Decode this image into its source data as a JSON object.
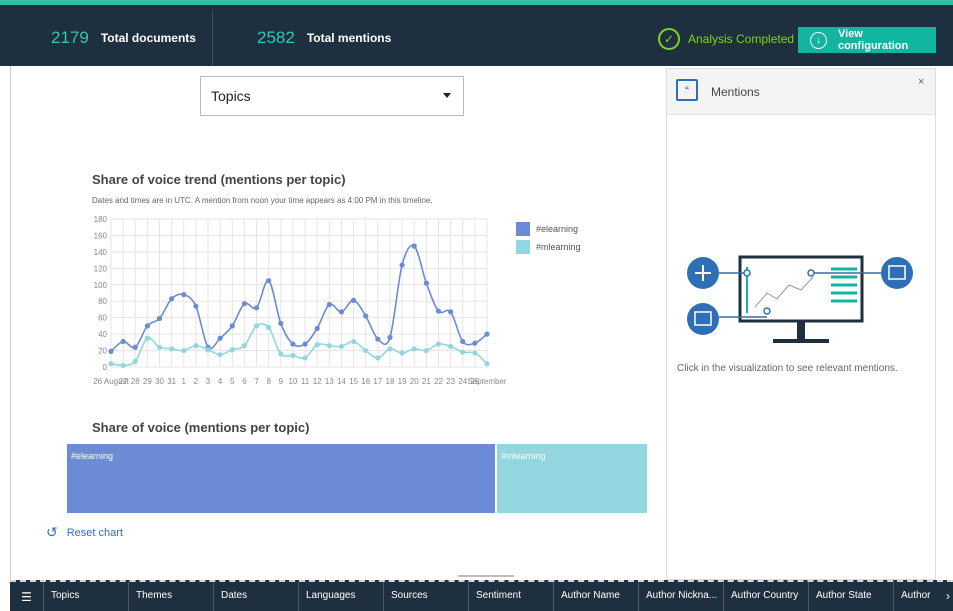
{
  "stats": [
    {
      "value": "2179",
      "label": "Total documents"
    },
    {
      "value": "2582",
      "label": "Total mentions"
    }
  ],
  "status": {
    "label": "Analysis Completed"
  },
  "view_config": {
    "label": "View configuration"
  },
  "selector": {
    "value": "Topics"
  },
  "trend": {
    "title": "Share of voice trend (mentions per topic)",
    "subtitle": "Dates and times are in UTC. A mention from noon your time appears as 4:00 PM in this timeline."
  },
  "share": {
    "title": "Share of voice (mentions per topic)"
  },
  "reset": {
    "label": "Reset chart"
  },
  "panel": {
    "title": "Mentions",
    "close": "×",
    "hint": "Click in the visualization to see relevant mentions."
  },
  "tabs": [
    "Topics",
    "Themes",
    "Dates",
    "Languages",
    "Sources",
    "Sentiment",
    "Author Name",
    "Author Nickna...",
    "Author Country",
    "Author State",
    "Author"
  ],
  "chart_data": [
    {
      "type": "line",
      "title": "Share of voice trend (mentions per topic)",
      "x": [
        "26 August",
        "27",
        "28",
        "29",
        "30",
        "31",
        "1",
        "2",
        "3",
        "4",
        "5",
        "6",
        "7",
        "8",
        "9",
        "10",
        "11",
        "12",
        "13",
        "14",
        "15",
        "16",
        "17",
        "18",
        "19",
        "20",
        "21",
        "22",
        "23",
        "24",
        "25",
        "September"
      ],
      "series": [
        {
          "name": "#elearning",
          "color": "#6b8cd4",
          "values": [
            19,
            31,
            24,
            50,
            59,
            83,
            88,
            74,
            24,
            35,
            50,
            77,
            72,
            105,
            53,
            28,
            28,
            47,
            76,
            67,
            81,
            62,
            34,
            36,
            124,
            147,
            102,
            68,
            67,
            31,
            29,
            40
          ]
        },
        {
          "name": "#mlearning",
          "color": "#93d6df",
          "values": [
            4,
            2,
            7,
            35,
            24,
            22,
            20,
            26,
            21,
            15,
            21,
            26,
            50,
            48,
            16,
            14,
            11,
            27,
            26,
            25,
            31,
            20,
            11,
            22,
            17,
            22,
            20,
            28,
            25,
            18,
            17,
            4
          ]
        }
      ],
      "ylim": [
        0,
        180
      ],
      "yticks": [
        0,
        20,
        40,
        60,
        80,
        100,
        120,
        140,
        160,
        180
      ],
      "grid": true,
      "legend": "right"
    },
    {
      "type": "treemap",
      "title": "Share of voice (mentions per topic)",
      "categories": [
        "#elearning",
        "#mlearning"
      ],
      "values": [
        74,
        26
      ]
    }
  ]
}
